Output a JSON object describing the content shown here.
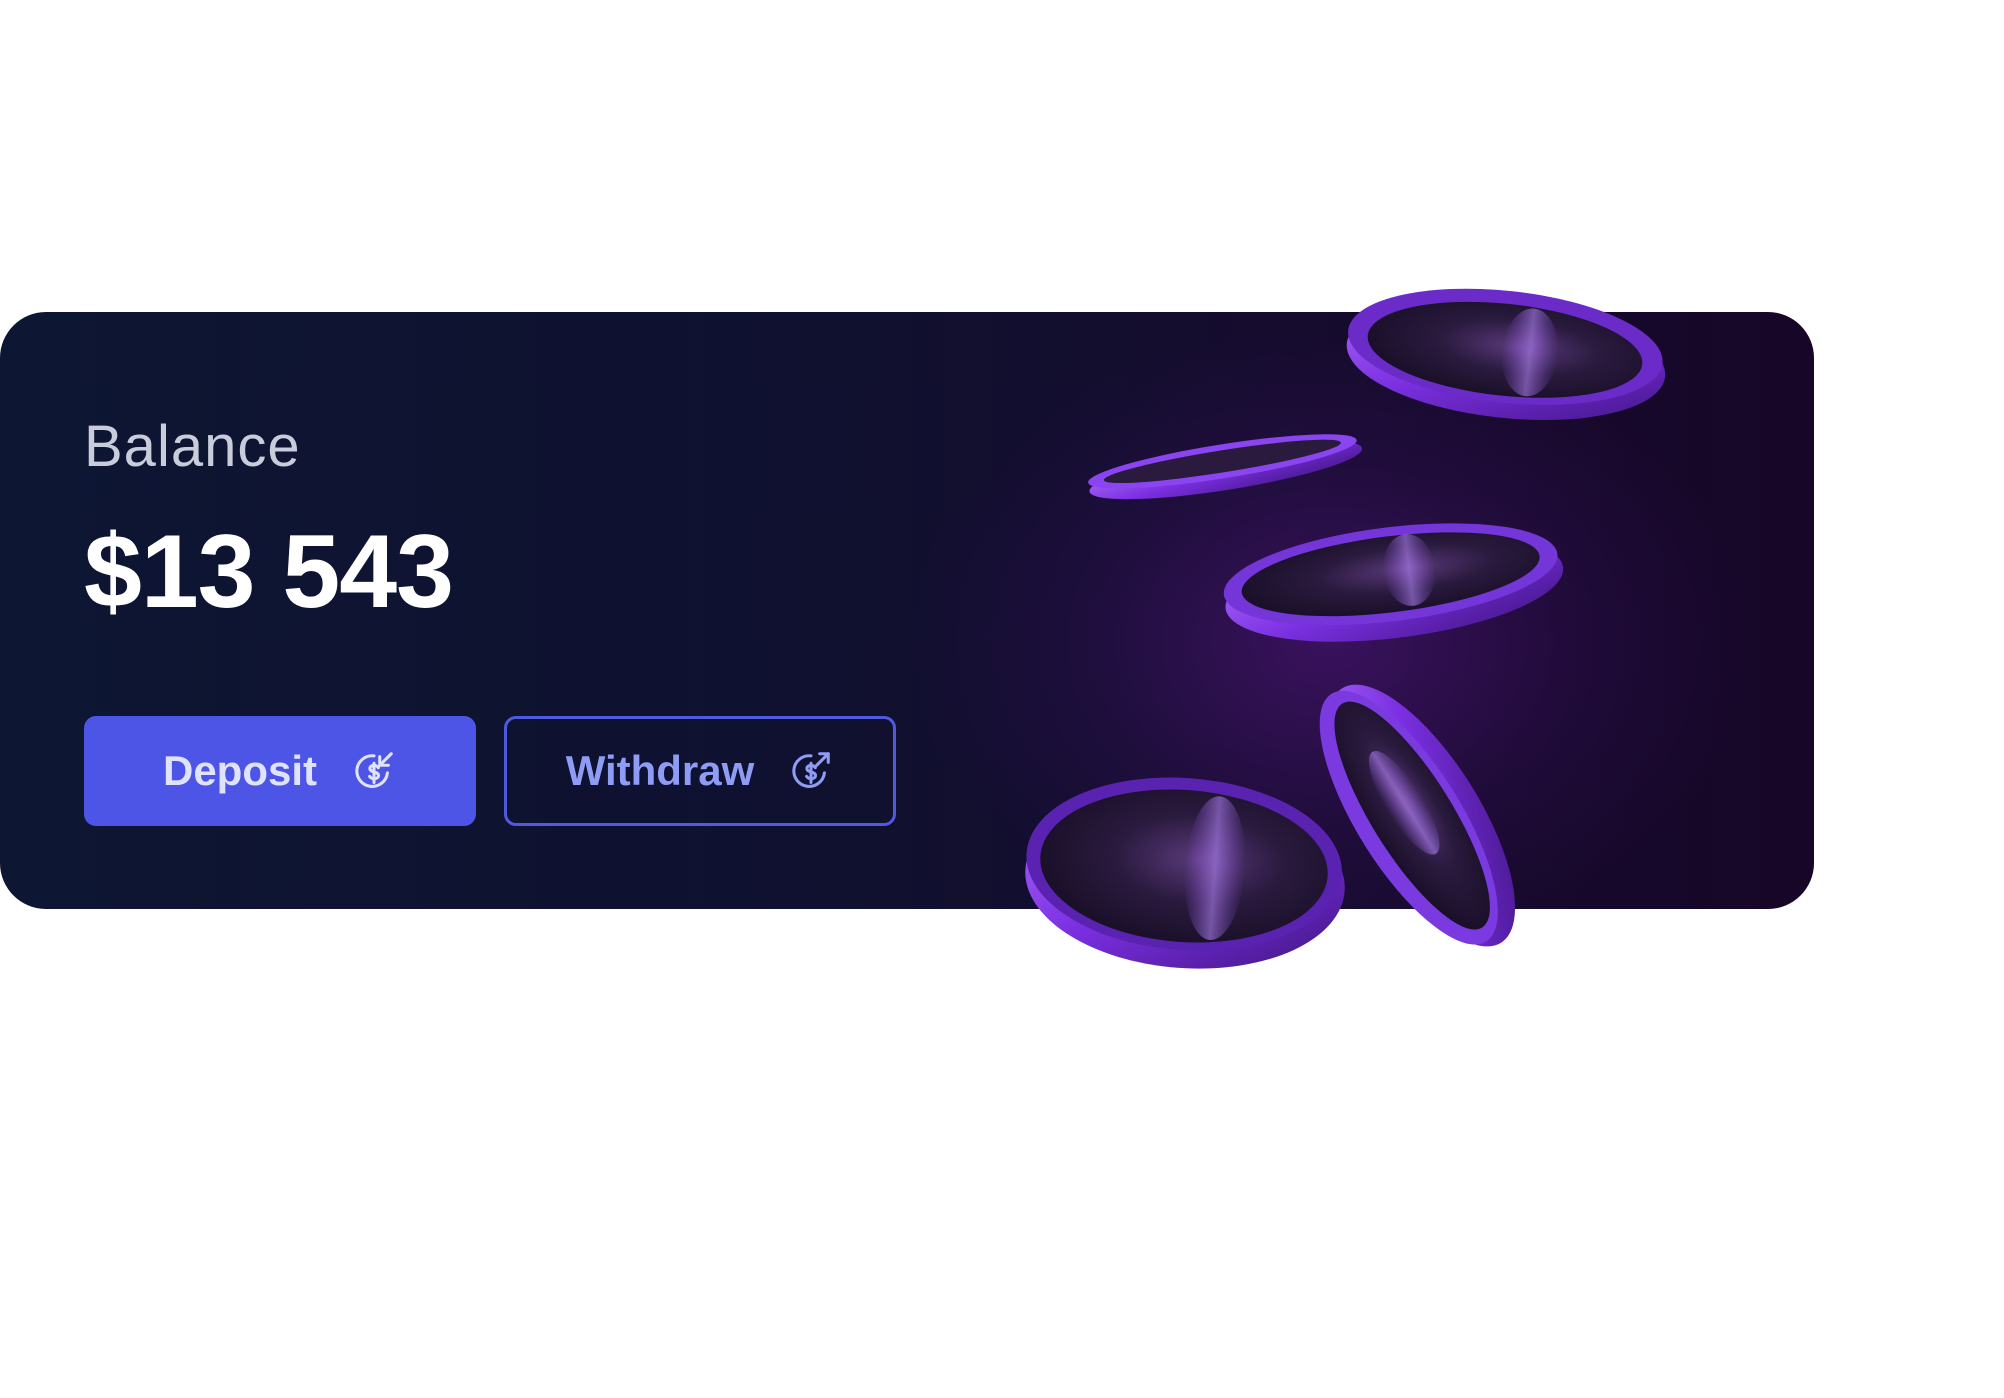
{
  "card": {
    "label": "Balance",
    "amount": "$13 543"
  },
  "actions": {
    "deposit_label": "Deposit",
    "deposit_icon": "dollar-in-arrow-icon",
    "withdraw_label": "Withdraw",
    "withdraw_icon": "dollar-out-arrow-icon"
  },
  "colors": {
    "card_bg_start": "#0d1632",
    "card_bg_end": "#170628",
    "deposit_bg": "#4c55e6",
    "withdraw_border": "#4f5ae0",
    "coin_accent": "#8a3cf0"
  },
  "illustration": "purple-coins-icon"
}
